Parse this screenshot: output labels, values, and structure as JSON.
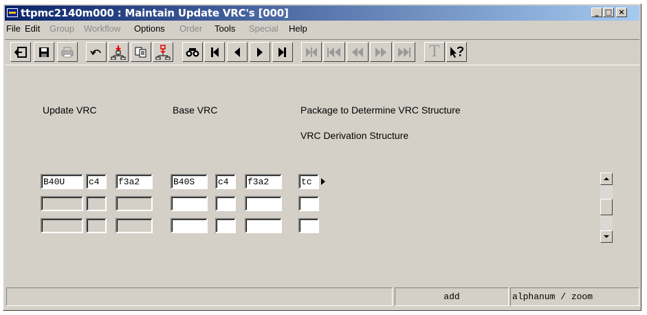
{
  "window": {
    "title": "ttpmc2140m000 : Maintain Update VRC's [000]"
  },
  "title_buttons": {
    "minimize": "_",
    "maximize": "□",
    "close": "×"
  },
  "menu": [
    "File",
    "Edit",
    "Group",
    "Workflow",
    "Options",
    "Order",
    "Tools",
    "Special",
    "Help"
  ],
  "toolbar": {
    "text_button": "T",
    "icons": [
      "exit-icon",
      "save-icon",
      "print-icon",
      "undo-icon",
      "insert-record-icon",
      "copy-icon",
      "delete-record-icon",
      "find-icon",
      "first-record-icon",
      "previous-record-icon",
      "next-record-icon",
      "last-record-icon",
      "first-group-icon",
      "previous-group-icon",
      "rewind-icon",
      "forward-icon",
      "last-group-icon",
      "text-icon",
      "context-help-icon"
    ]
  },
  "form": {
    "labels": {
      "update_vrc": "Update VRC",
      "base_vrc": "Base VRC",
      "package": "Package to Determine VRC Structure",
      "derivation": "VRC Derivation Structure"
    },
    "row1": {
      "update_version": "B40U",
      "update_release": "c4",
      "update_customer": "f3a2",
      "base_version": "B40S",
      "base_release": "c4",
      "base_customer": "f3a2",
      "package": "tc"
    }
  },
  "status": {
    "mode": "add",
    "field_type": "alphanum / zoom"
  }
}
